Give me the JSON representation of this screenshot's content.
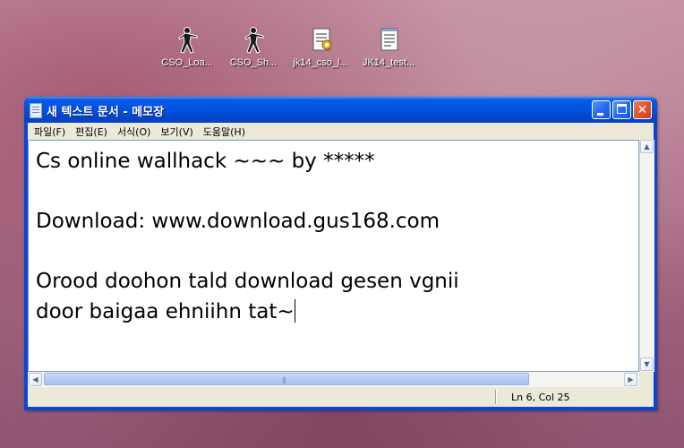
{
  "desktop": {
    "icons": [
      {
        "label": "CSO_Loa...",
        "icon": "cs-soldier-icon"
      },
      {
        "label": "CSO_Sh...",
        "icon": "cs-soldier-icon"
      },
      {
        "label": "jk14_cso_l...",
        "icon": "notepad-config-icon"
      },
      {
        "label": "JK14_test...",
        "icon": "text-file-icon"
      }
    ]
  },
  "window": {
    "title": "새 텍스트 문서 - 메모장",
    "controls": {
      "minimize": "minimize",
      "maximize": "maximize",
      "close": "✕"
    },
    "menu": [
      "파일(F)",
      "편집(E)",
      "서식(O)",
      "보기(V)",
      "도움말(H)"
    ],
    "content": {
      "lines": [
        "Cs online wallhack ~~~ by *****",
        "",
        "Download: www.download.gus168.com",
        "",
        "Orood doohon tald download gesen vgnii",
        "door baigaa ehniihn tat~"
      ]
    },
    "status": {
      "position": "Ln 6, Col 25"
    }
  },
  "colors": {
    "titlebar": "#0054e3",
    "accent": "#0a46d6"
  }
}
